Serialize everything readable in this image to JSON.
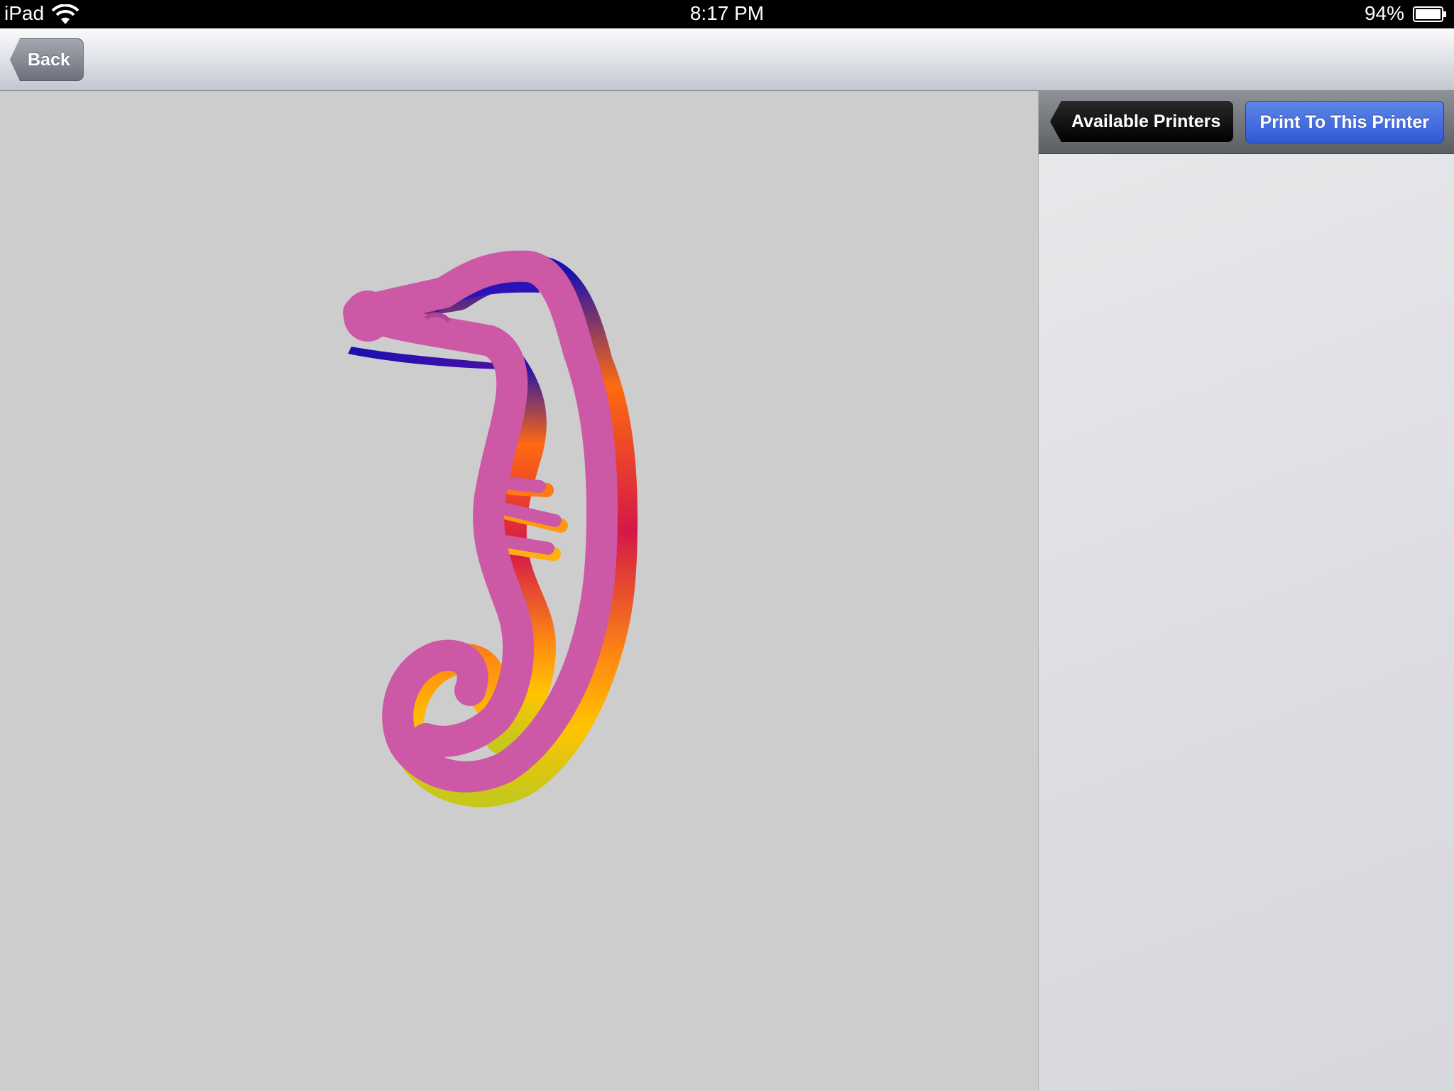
{
  "status_bar": {
    "carrier": "iPad",
    "time": "8:17 PM",
    "battery_percent": "94%"
  },
  "nav_bar": {
    "back_label": "Back"
  },
  "panel": {
    "available_printers_label": "Available Printers",
    "print_label": "Print To This Printer"
  },
  "model": {
    "description_icon": "seahorse-3d-model",
    "face_color": "#cc58a6"
  }
}
